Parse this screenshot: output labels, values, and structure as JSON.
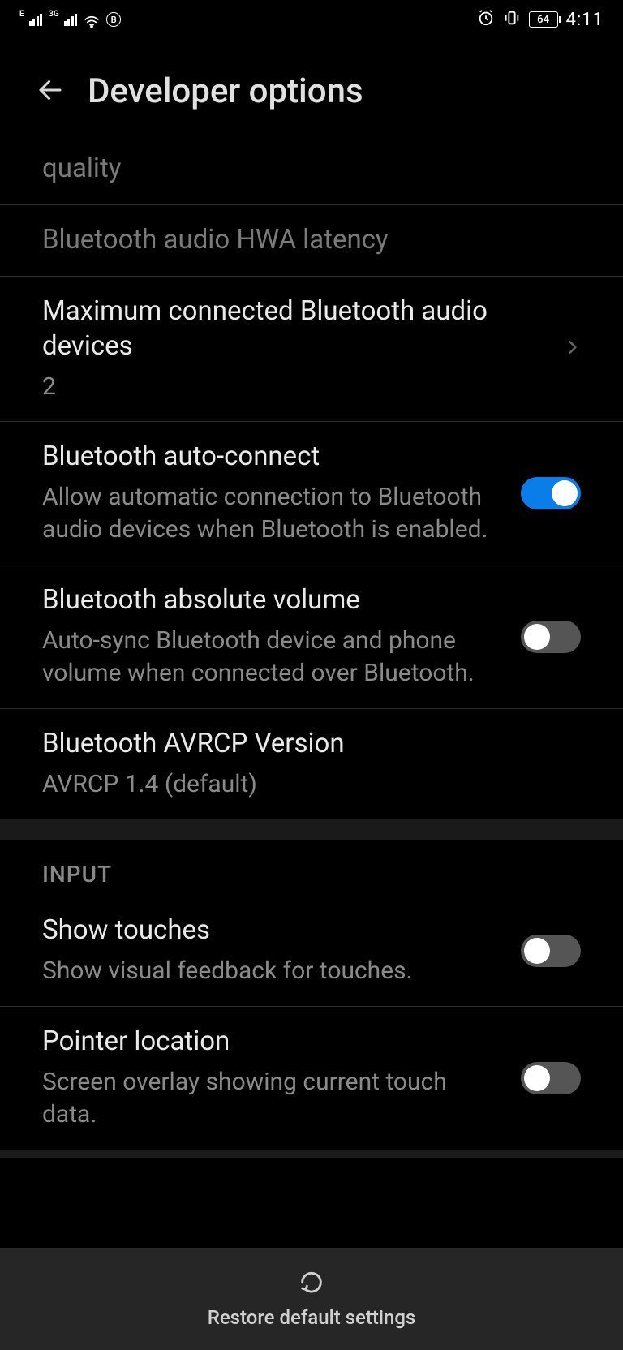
{
  "statusBar": {
    "signal1Label": "E",
    "signal2Label": "3G",
    "circleLetter": "B",
    "battery": "64",
    "time": "4:11"
  },
  "header": {
    "title": "Developer options"
  },
  "items": {
    "quality": {
      "title": "quality"
    },
    "hwaLatency": {
      "title": "Bluetooth audio HWA latency"
    },
    "maxDevices": {
      "title": "Maximum connected Bluetooth audio devices",
      "value": "2"
    },
    "autoConnect": {
      "title": "Bluetooth auto-connect",
      "desc": "Allow automatic connection to Bluetooth audio devices when Bluetooth is enabled."
    },
    "absoluteVolume": {
      "title": "Bluetooth absolute volume",
      "desc": "Auto-sync Bluetooth device and phone volume when connected over Bluetooth."
    },
    "avrcp": {
      "title": "Bluetooth AVRCP Version",
      "value": "AVRCP 1.4 (default)"
    },
    "showTouches": {
      "title": "Show touches",
      "desc": "Show visual feedback for touches."
    },
    "pointerLocation": {
      "title": "Pointer location",
      "desc": "Screen overlay showing current touch data."
    }
  },
  "sections": {
    "input": "INPUT"
  },
  "bottomBar": {
    "label": "Restore default settings"
  }
}
